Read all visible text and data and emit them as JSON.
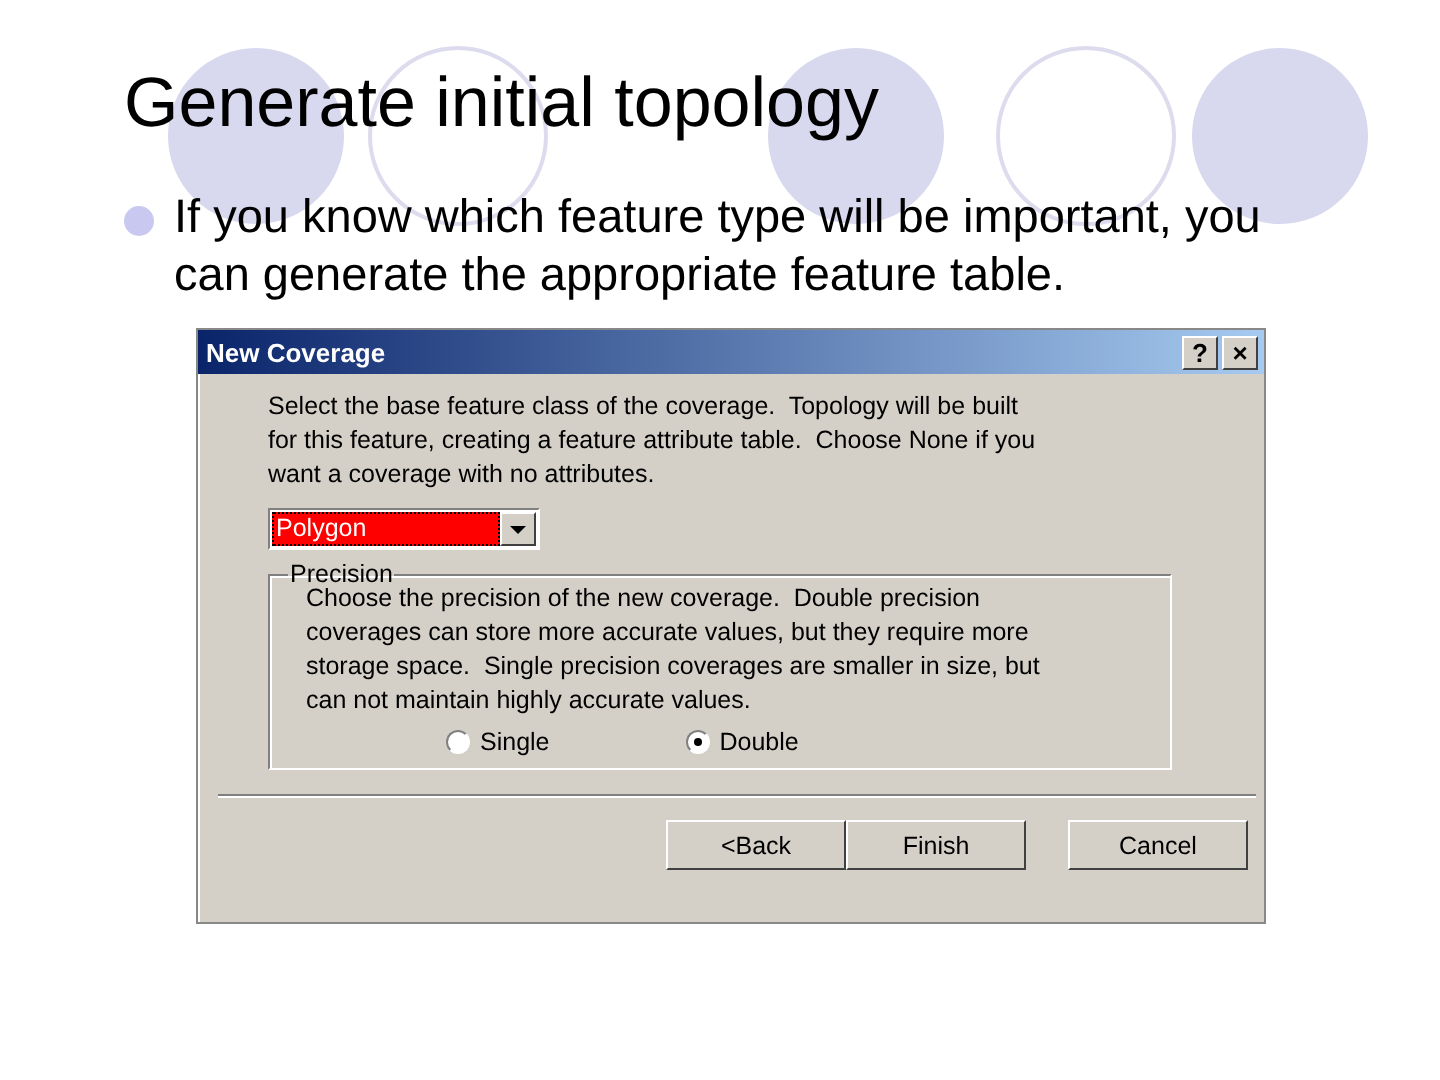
{
  "slide": {
    "title": "Generate initial topology",
    "bullets": [
      "If you know which feature type will be important, you can generate the appropriate feature table."
    ]
  },
  "dialog": {
    "title": "New Coverage",
    "title_buttons": [
      "?",
      "×"
    ],
    "intro": "Select the base feature class of the coverage.  Topology will be built for this feature, creating a feature attribute table.  Choose None if you want a coverage with no attributes.",
    "feature_class": {
      "value": "Polygon"
    },
    "precision": {
      "label": "Precision",
      "description": "Choose the precision of the new coverage.  Double precision coverages can store more accurate values, but they require more storage space.  Single precision coverages are smaller in size, but can not maintain highly accurate values.",
      "options": [
        {
          "label": "Single",
          "selected": false
        },
        {
          "label": "Double",
          "selected": true
        }
      ]
    },
    "buttons": [
      "<Back",
      "Finish",
      "Cancel"
    ]
  }
}
